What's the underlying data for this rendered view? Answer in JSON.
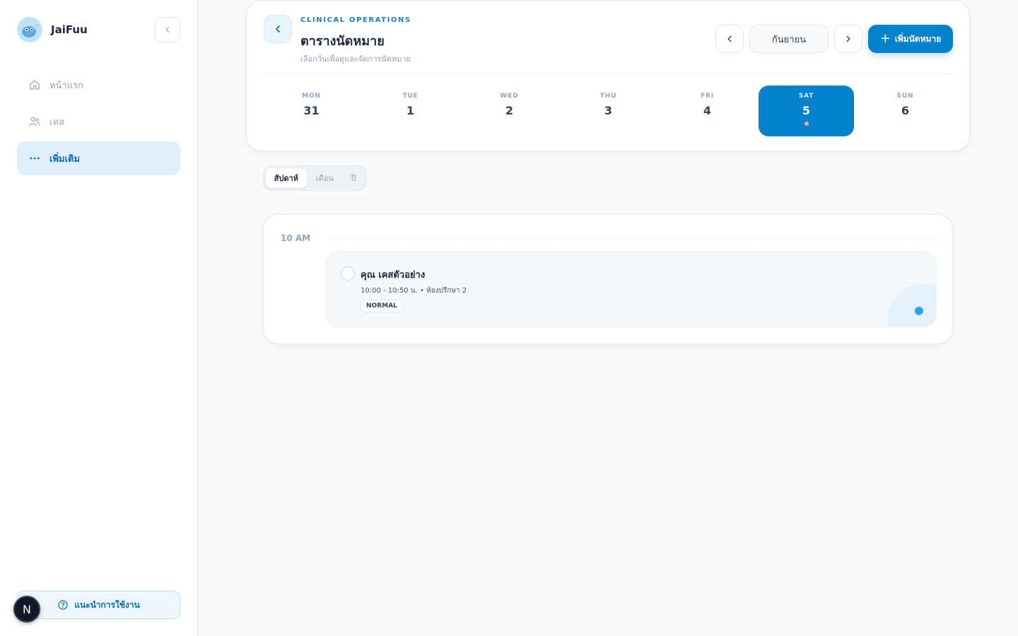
{
  "app": {
    "name": "JaiFuu"
  },
  "sidebar": {
    "items": [
      {
        "label": "หน้าแรก",
        "icon": "home-icon",
        "active": false
      },
      {
        "label": "เคส",
        "icon": "users-icon",
        "active": false
      },
      {
        "label": "เพิ่มเติม",
        "icon": "more-icon",
        "active": true
      }
    ],
    "help_label": "แนะนำการใช้งาน",
    "badge_letter": "N"
  },
  "header": {
    "eyebrow": "CLINICAL OPERATIONS",
    "title": "ตารางนัดหมาย",
    "subtitle": "เลือกวันเพื่อดูและจัดการนัดหมาย",
    "month": "กันยายน",
    "add_label": "เพิ่มนัดหมาย"
  },
  "week": {
    "days": [
      {
        "name": "MON",
        "num": "31"
      },
      {
        "name": "TUE",
        "num": "1"
      },
      {
        "name": "WED",
        "num": "2"
      },
      {
        "name": "THU",
        "num": "3"
      },
      {
        "name": "FRI",
        "num": "4"
      },
      {
        "name": "SAT",
        "num": "5"
      },
      {
        "name": "SUN",
        "num": "6"
      }
    ],
    "selected": "SAT"
  },
  "view": {
    "tabs": [
      {
        "label": "สัปดาห์",
        "active": true
      },
      {
        "label": "เดือน",
        "active": false
      },
      {
        "label": "ปี",
        "active": false
      }
    ]
  },
  "schedule": {
    "time_label": "10 AM",
    "appointment": {
      "name": "คุณ เคสตัวอย่าง",
      "meta": "10:00 - 10:50 น. • ห้องปรึกษา 2",
      "badge": "NORMAL"
    }
  },
  "colors": {
    "accent": "#0582cc",
    "accent_light": "#e0f0fb",
    "indicator": "#2ea8e0",
    "event_dot": "#f4a3b5"
  }
}
